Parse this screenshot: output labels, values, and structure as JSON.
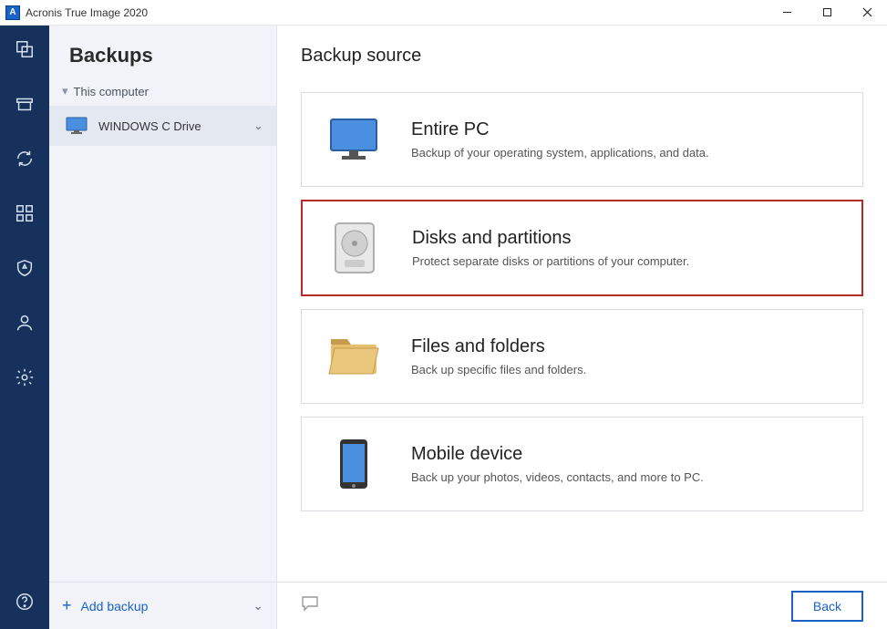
{
  "titlebar": {
    "title": "Acronis True Image 2020",
    "logo_letter": "A"
  },
  "sidebar": {
    "heading": "Backups",
    "tree_root": "This computer",
    "items": [
      {
        "label": "WINDOWS C Drive"
      }
    ],
    "add_label": "Add backup"
  },
  "main": {
    "heading": "Backup source",
    "cards": [
      {
        "title": "Entire PC",
        "desc": "Backup of your operating system, applications, and data.",
        "highlight": false,
        "icon": "monitor"
      },
      {
        "title": "Disks and partitions",
        "desc": "Protect separate disks or partitions of your computer.",
        "highlight": true,
        "icon": "hdd"
      },
      {
        "title": "Files and folders",
        "desc": "Back up specific files and folders.",
        "highlight": false,
        "icon": "folder"
      },
      {
        "title": "Mobile device",
        "desc": "Back up your photos, videos, contacts, and more to PC.",
        "highlight": false,
        "icon": "phone"
      }
    ],
    "back_label": "Back"
  }
}
